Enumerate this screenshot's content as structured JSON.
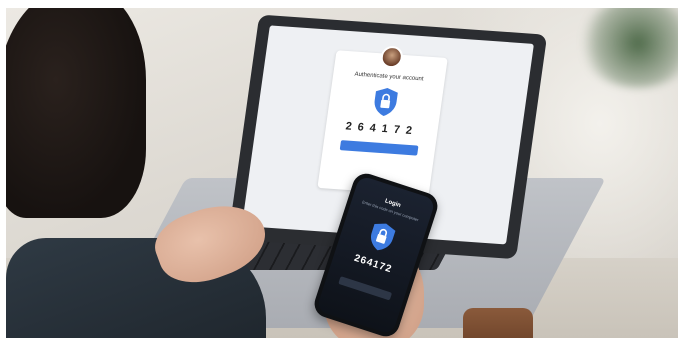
{
  "scene": {
    "accent": "#3d7be0",
    "laptop": {
      "card_title": "Authenticate your account",
      "code": "264172",
      "shield": "shield-lock-icon"
    },
    "phone": {
      "title": "Login",
      "subtitle": "Enter this code on your computer",
      "code": "264172",
      "shield": "shield-lock-icon"
    }
  }
}
